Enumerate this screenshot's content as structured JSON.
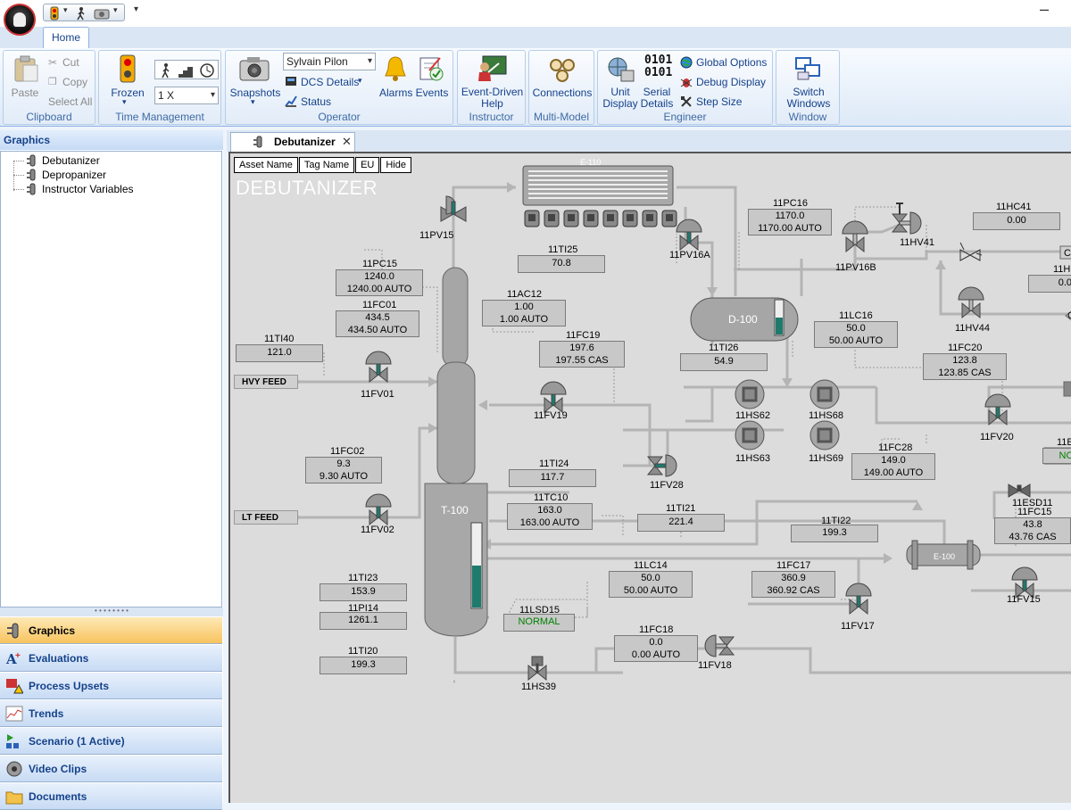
{
  "window": {
    "minimize_label": "–"
  },
  "ribbon": {
    "tab_home": "Home",
    "clipboard": {
      "label": "Clipboard",
      "paste": "Paste",
      "cut": "Cut",
      "copy": "Copy",
      "select_all": "Select All"
    },
    "time": {
      "label": "Time Management",
      "frozen": "Frozen",
      "speed": "1 X"
    },
    "operator": {
      "label": "Operator",
      "snapshots": "Snapshots",
      "user": "Sylvain Pilon",
      "dcs": "DCS Details",
      "status": "Status",
      "alarms": "Alarms",
      "events": "Events"
    },
    "instructor": {
      "label": "Instructor",
      "help": "Event-Driven Help"
    },
    "multimodel": {
      "label": "Multi-Model",
      "connections": "Connections"
    },
    "engineer": {
      "label": "Engineer",
      "unit_display": "Unit Display",
      "serial": "Serial Details",
      "global": "Global Options",
      "debug": "Debug Display",
      "step": "Step Size"
    },
    "window": {
      "label": "Window",
      "switch": "Switch Windows"
    }
  },
  "left": {
    "header": "Graphics",
    "tree": [
      "Debutanizer",
      "Depropanizer",
      "Instructor Variables"
    ],
    "nav": [
      "Graphics",
      "Evaluations",
      "Process Upsets",
      "Trends",
      "Scenario (1 Active)",
      "Video Clips",
      "Documents"
    ]
  },
  "doc": {
    "tab": "Debutanizer",
    "header_buttons": [
      "Asset Name",
      "Tag Name",
      "EU",
      "Hide"
    ],
    "title": "DEBUTANIZER"
  },
  "pid": {
    "equipment": {
      "t100": "T-100",
      "d100": "D-100",
      "e100": "E-100",
      "e110": "E-110"
    },
    "feeds": {
      "hvy": "HVY FEED",
      "lt": "LT FEED"
    },
    "valves": [
      "11PV15",
      "11PV16A",
      "11PV16B",
      "11HV41",
      "11HV44",
      "11FV01",
      "11FV19",
      "11FV20",
      "11FV28",
      "11FV02",
      "11FV17",
      "11FV18",
      "11FV15",
      "11HS39",
      "11ESD11"
    ],
    "motors": [
      "11HS62",
      "11HS68",
      "11HS63",
      "11HS69"
    ],
    "points": {
      "TI25": {
        "tag": "11TI25",
        "v1": "70.8"
      },
      "PC15": {
        "tag": "11PC15",
        "v1": "1240.0",
        "v2": "1240.00 AUTO"
      },
      "FC01": {
        "tag": "11FC01",
        "v1": "434.5",
        "v2": "434.50 AUTO"
      },
      "AC12": {
        "tag": "11AC12",
        "v1": "1.00",
        "v2": "1.00 AUTO"
      },
      "FC19": {
        "tag": "11FC19",
        "v1": "197.6",
        "v2": "197.55 CAS"
      },
      "TI40": {
        "tag": "11TI40",
        "v1": "121.0"
      },
      "PC16": {
        "tag": "11PC16",
        "v1": "1170.0",
        "v2": "1170.00 AUTO"
      },
      "HC41": {
        "tag": "11HC41",
        "v1": "0.00"
      },
      "LC16": {
        "tag": "11LC16",
        "v1": "50.0",
        "v2": "50.00 AUTO"
      },
      "TI26": {
        "tag": "11TI26",
        "v1": "54.9"
      },
      "FC20": {
        "tag": "11FC20",
        "v1": "123.8",
        "v2": "123.85 CAS"
      },
      "FC02": {
        "tag": "11FC02",
        "v1": "9.3",
        "v2": "9.30 AUTO"
      },
      "TI24": {
        "tag": "11TI24",
        "v1": "117.7"
      },
      "FC28": {
        "tag": "11FC28",
        "v1": "149.0",
        "v2": "149.00 AUTO"
      },
      "TC10": {
        "tag": "11TC10",
        "v1": "163.0",
        "v2": "163.00 AUTO"
      },
      "TI21": {
        "tag": "11TI21",
        "v1": "221.4"
      },
      "TI22": {
        "tag": "11TI22",
        "v1": "199.3"
      },
      "FC15": {
        "tag": "11FC15",
        "v1": "43.8",
        "v2": "43.76 CAS"
      },
      "TI23": {
        "tag": "11TI23",
        "v1": "153.9"
      },
      "LC14": {
        "tag": "11LC14",
        "v1": "50.0",
        "v2": "50.00 AUTO"
      },
      "FC17": {
        "tag": "11FC17",
        "v1": "360.9",
        "v2": "360.92 CAS"
      },
      "PI14": {
        "tag": "11PI14",
        "v1": "1261.1"
      },
      "LSD15": {
        "tag": "11LSD15",
        "v1": "NORMAL"
      },
      "TI20": {
        "tag": "11TI20",
        "v1": "199.3"
      },
      "FC18": {
        "tag": "11FC18",
        "v1": "0.0",
        "v2": "0.00 AUTO"
      }
    },
    "edge": {
      "c1": "C",
      "hl": "11H",
      "hv": "0.0",
      "e1": "11E",
      "no": "NO"
    }
  },
  "colors": {
    "accent": "#15428b",
    "level": "#1f7a6e",
    "normal": "#008000",
    "nav_active": "#f8c35e"
  }
}
